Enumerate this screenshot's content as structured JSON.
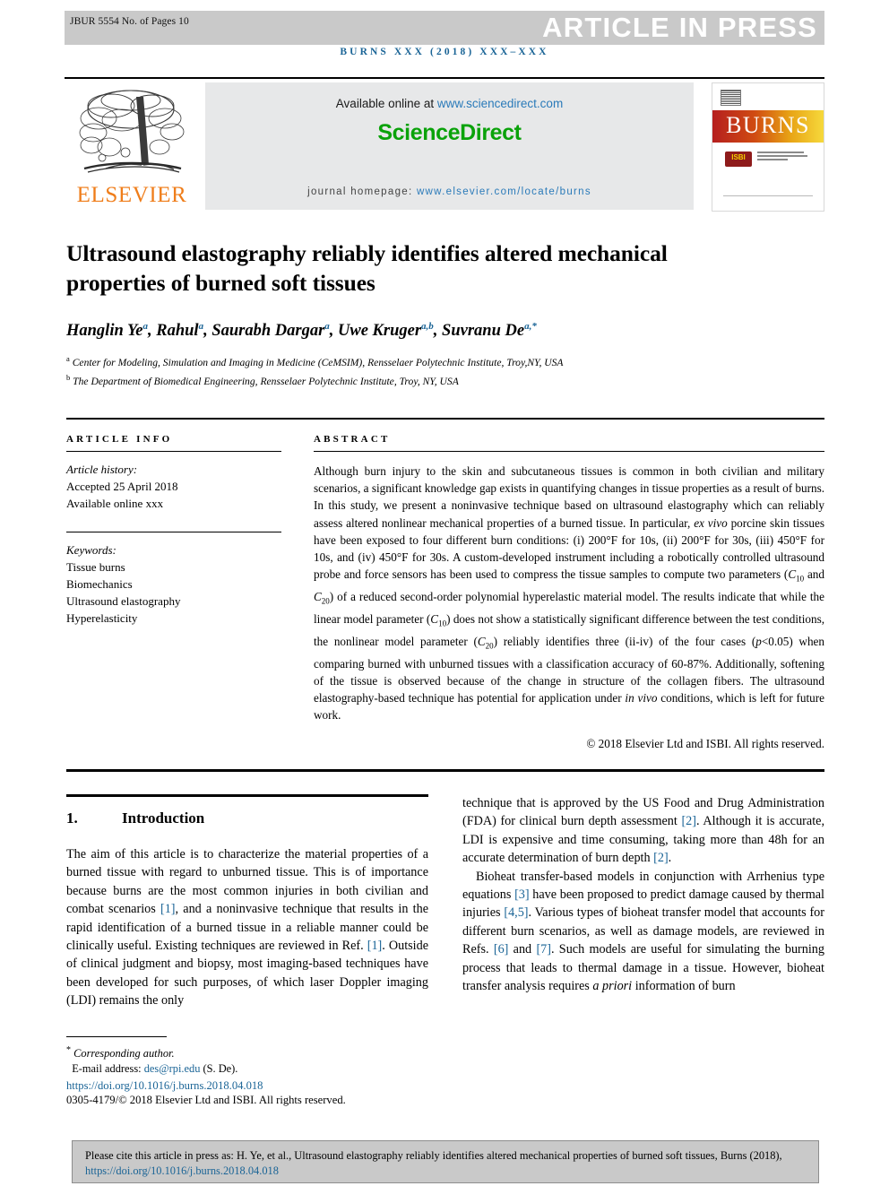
{
  "runhead": {
    "article_id": "JBUR 5554 No. of Pages 10",
    "status_banner": "ARTICLE IN PRESS",
    "journal_citation": "BURNS XXX (2018) XXX–XXX"
  },
  "masthead": {
    "publisher": "ELSEVIER",
    "available_prefix": "Available online at ",
    "available_url": "www.sciencedirect.com",
    "sciencedirect_logo": "ScienceDirect",
    "homepage_prefix": "journal homepage: ",
    "homepage_url": "www.elsevier.com/locate/burns",
    "cover": {
      "journal_name": "BURNS",
      "society_badge": "ISBI",
      "society_name": "JOURNAL OF THE INTERNATIONAL SOCIETY FOR BURN INJURIES"
    }
  },
  "article": {
    "title": "Ultrasound elastography reliably identifies altered mechanical properties of burned soft tissues",
    "authors": "Hanglin Ye a, Rahul a, Saurabh Dargar a, Uwe Kruger a,b, Suvranu De a,*",
    "affiliation_a": "Center for Modeling, Simulation and Imaging in Medicine (CeMSIM), Rensselaer Polytechnic Institute, Troy,NY, USA",
    "affiliation_b": "The Department of Biomedical Engineering, Rensselaer Polytechnic Institute, Troy, NY, USA"
  },
  "info": {
    "heading": "ARTICLE INFO",
    "history_label": "Article history:",
    "history_accepted": "Accepted 25 April 2018",
    "history_online": "Available online xxx",
    "keywords_label": "Keywords:",
    "keywords": [
      "Tissue burns",
      "Biomechanics",
      "Ultrasound elastography",
      "Hyperelasticity"
    ]
  },
  "abstract": {
    "heading": "ABSTRACT",
    "p1_a": "Although burn injury to the skin and subcutaneous tissues is common in both civilian and military scenarios, a significant knowledge gap exists in quantifying changes in tissue properties as a result of burns. In this study, we present a noninvasive technique based on ultrasound elastography which can reliably assess altered nonlinear mechanical properties of a burned tissue. In particular, ",
    "p1_ital1": "ex vivo",
    "p1_b": " porcine skin tissues have been exposed to four different burn conditions: (i) 200°F for 10s, (ii) 200°F for 30s, (iii) 450°F for 10s, and (iv) 450°F for 30s. A custom-developed instrument including a robotically controlled ultrasound probe and force sensors has been used to compress the tissue samples to compute two parameters (",
    "p1_c1": "C",
    "p1_c1s": "10",
    "p1_c": " and ",
    "p1_c2": "C",
    "p1_c2s": "20",
    "p1_d": ") of a reduced second-order polynomial hyperelastic material model. The results indicate that while the linear model parameter (",
    "p1_c3": "C",
    "p1_c3s": "10",
    "p1_e": ") does not show a statistically significant difference between the test conditions, the nonlinear model parameter (",
    "p1_c4": "C",
    "p1_c4s": "20",
    "p1_f": ") reliably identifies three (ii-iv) of the four cases (",
    "p1_ital2": "p",
    "p1_g": "<0.05) when comparing burned with unburned tissues with a classification accuracy of 60-87%. Additionally, softening of the tissue is observed because of the change in structure of the collagen fibers. The ultrasound elastography-based technique has potential for application under ",
    "p1_ital3": "in vivo",
    "p1_h": " conditions, which is left for future work.",
    "copyright": "© 2018 Elsevier Ltd and ISBI. All rights reserved."
  },
  "body": {
    "section_number": "1.",
    "section_title": "Introduction",
    "left_p1_a": "The aim of this article is to characterize the material properties of a burned tissue with regard to unburned tissue. This is of importance because burns are the most common injuries in both civilian and combat scenarios ",
    "left_ref1": "[1]",
    "left_p1_b": ", and a noninvasive technique that results in the rapid identification of a burned tissue in a reliable manner could be clinically useful. Existing techniques are reviewed in Ref. ",
    "left_ref2": "[1]",
    "left_p1_c": ". Outside of clinical judgment and biopsy, most imaging-based techniques have been developed for such purposes, of which laser Doppler imaging (LDI) remains the only",
    "right_p1_a": "technique that is approved by the US Food and Drug Administration (FDA) for clinical burn depth assessment ",
    "right_ref1": "[2]",
    "right_p1_b": ". Although it is accurate, LDI is expensive and time consuming, taking more than 48h for an accurate determination of burn depth ",
    "right_ref2": "[2]",
    "right_p1_c": ".",
    "right_p2_a": "Bioheat transfer-based models in conjunction with Arrhenius type equations ",
    "right_ref3": "[3]",
    "right_p2_b": " have been proposed to predict damage caused by thermal injuries ",
    "right_ref4": "[4,5]",
    "right_p2_c": ". Various types of bioheat transfer model that accounts for different burn scenarios, as well as damage models, are reviewed in Refs. ",
    "right_ref5": "[6]",
    "right_p2_d": " and ",
    "right_ref6": "[7]",
    "right_p2_e": ". Such models are useful for simulating the burning process that leads to thermal damage in a tissue. However, bioheat transfer analysis requires ",
    "right_ital1": "a priori",
    "right_p2_f": " information of burn"
  },
  "footnote": {
    "star": "*",
    "corresponding": "Corresponding author.",
    "email_label": "E-mail address: ",
    "email": "des@rpi.edu",
    "email_suffix": " (S. De).",
    "doi": "https://doi.org/10.1016/j.burns.2018.04.018",
    "issn": "0305-4179/© 2018 Elsevier Ltd and ISBI. All rights reserved."
  },
  "citebox": {
    "text_a": "Please cite this article in press as: H. Ye, et al., Ultrasound elastography reliably identifies altered mechanical properties of burned soft tissues, Burns (2018), ",
    "link": "https://doi.org/10.1016/j.burns.2018.04.018"
  },
  "colors": {
    "link_blue": "#1a6496",
    "elsevier_orange": "#ef7d1a",
    "sciencedirect_green": "#0aa20a",
    "banner_gray": "#c9c9c9"
  }
}
